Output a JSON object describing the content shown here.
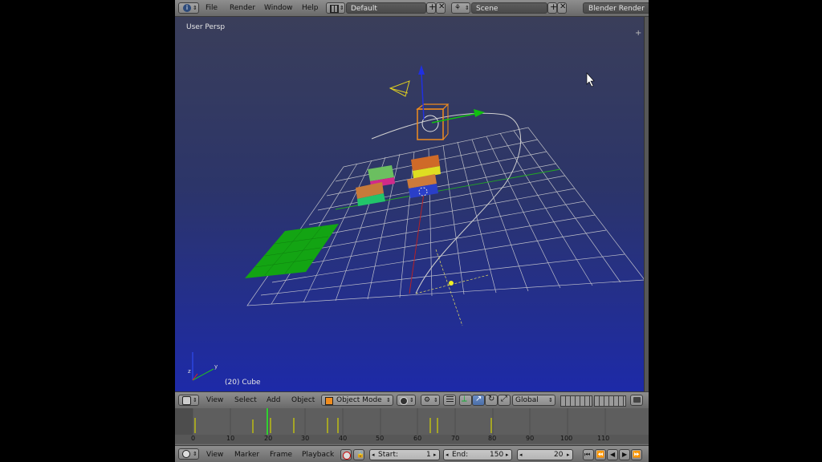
{
  "topbar": {
    "menus": [
      "File",
      "Render",
      "Window",
      "Help"
    ],
    "screen_layout": "Default",
    "scene": "Scene",
    "engine": "Blender Render"
  },
  "viewport": {
    "view_label": "User Persp",
    "object_label": "(20) Cube",
    "background_top": "#3a3e5a",
    "background_bottom": "#1d2aa8"
  },
  "view3d_header": {
    "menus": [
      "View",
      "Select",
      "Add",
      "Object"
    ],
    "mode": "Object Mode",
    "orientation": "Global"
  },
  "timeline": {
    "ruler_ticks": [
      "0",
      "10",
      "20",
      "30",
      "40",
      "50",
      "60",
      "70",
      "80",
      "90",
      "100",
      "110"
    ],
    "current_frame": 20
  },
  "timeline_header": {
    "menus": [
      "View",
      "Marker",
      "Frame",
      "Playback"
    ],
    "start_label": "Start:",
    "start_value": "1",
    "end_label": "End:",
    "end_value": "150",
    "frame_value": "20"
  },
  "colors": {
    "grid": "#d8d8d8",
    "selection": "#f08c1e",
    "plane": "#13a413",
    "keyframe": "#d4d400"
  }
}
